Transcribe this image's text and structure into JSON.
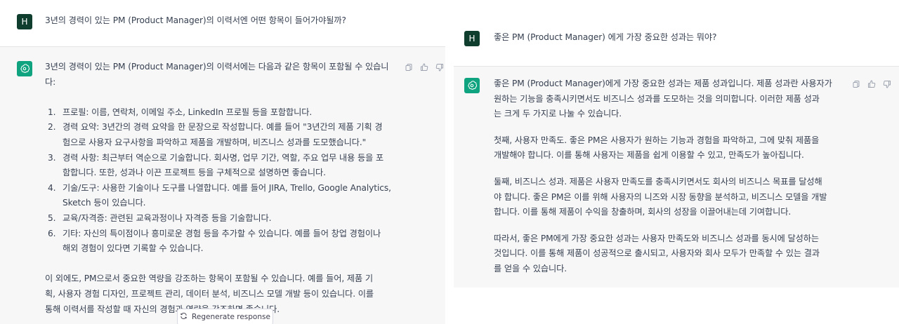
{
  "left": {
    "user_avatar": "H",
    "question": "3년의 경력이 있는 PM (Product Manager)의 이력서엔 어떤 항목이 들어가야될까?",
    "answer_intro_1": "3년의 경력이 있는 PM (Product Manager)의 이력서에는 다음과 같은 항목이 포함될 수 있습니",
    "answer_intro_2": "다:",
    "list": [
      {
        "num": "1.",
        "lines": [
          "프로필: 이름, 연락처, 이메일 주소, LinkedIn 프로필 등을 포함합니다."
        ]
      },
      {
        "num": "2.",
        "lines": [
          "경력 요약: 3년간의 경력 요약을 한 문장으로 작성합니다. 예를 들어 \"3년간의 제품 기획 경",
          "험으로 사용자 요구사항을 파악하고 제품을 개발하며, 비즈니스 성과를 도모했습니다.\""
        ]
      },
      {
        "num": "3.",
        "lines": [
          "경력 사항: 최근부터 역순으로 기술합니다. 회사명, 업무 기간, 역할, 주요 업무 내용 등을 포",
          "함합니다. 또한, 성과나 이끈 프로젝트 등을 구체적으로 설명하면 좋습니다."
        ]
      },
      {
        "num": "4.",
        "lines": [
          "기술/도구: 사용한 기술이나 도구를 나열합니다. 예를 들어 JIRA, Trello, Google Analytics,",
          "Sketch 등이 있습니다."
        ]
      },
      {
        "num": "5.",
        "lines": [
          "교육/자격증: 관련된 교육과정이나 자격증 등을 기술합니다."
        ]
      },
      {
        "num": "6.",
        "lines": [
          "기타: 자신의 특이점이나 흥미로운 경험 등을 추가할 수 있습니다. 예를 들어 창업 경험이나",
          "해외 경험이 있다면 기록할 수 있습니다."
        ]
      }
    ],
    "outro": [
      "이 외에도, PM으로서 중요한 역량을 강조하는 항목이 포함될 수 있습니다. 예를 들어, 제품 기",
      "획, 사용자 경험 디자인, 프로젝트 관리, 데이터 분석, 비즈니스 모델 개발 등이 있습니다. 이를",
      "통해 이력서를 작성할 때 자신의 경험과 역량을 강조하면 좋습니다."
    ],
    "regenerate_label": "Regenerate response"
  },
  "right": {
    "user_avatar": "H",
    "question": "좋은 PM (Product Manager) 에게 가장 중요한 성과는 뭐야?",
    "paragraphs": [
      [
        "좋은 PM (Product Manager)에게 가장 중요한 성과는 제품 성과입니다. 제품 성과란 사용자가",
        "원하는 기능을 충족시키면서도 비즈니스 성과를 도모하는 것을 의미합니다. 이러한 제품 성과",
        "는 크게 두 가지로 나눌 수 있습니다."
      ],
      [
        "첫째, 사용자 만족도. 좋은 PM은 사용자가 원하는 기능과 경험을 파악하고, 그에 맞춰 제품을",
        "개발해야 합니다. 이를 통해 사용자는 제품을 쉽게 이용할 수 있고, 만족도가 높아집니다."
      ],
      [
        "둘째, 비즈니스 성과. 제품은 사용자 만족도를 충족시키면서도 회사의 비즈니스 목표를 달성해",
        "야 합니다. 좋은 PM은 이를 위해 사용자의 니즈와 시장 동향을 분석하고, 비즈니스 모델을 개발",
        "합니다. 이를 통해 제품이 수익을 창출하며, 회사의 성장을 이끌어내는데 기여합니다."
      ],
      [
        "따라서, 좋은 PM에게 가장 중요한 성과는 사용자 만족도와 비즈니스 성과를 동시에 달성하는",
        "것입니다. 이를 통해 제품이 성공적으로 출시되고, 사용자와 회사 모두가 만족할 수 있는 결과",
        "를 얻을 수 있습니다."
      ]
    ]
  },
  "colors": {
    "ai_bg": "#f7f7f8",
    "user_avatar_bg": "#0f3d2e",
    "ai_avatar_bg": "#10a37f",
    "text": "#374151"
  }
}
